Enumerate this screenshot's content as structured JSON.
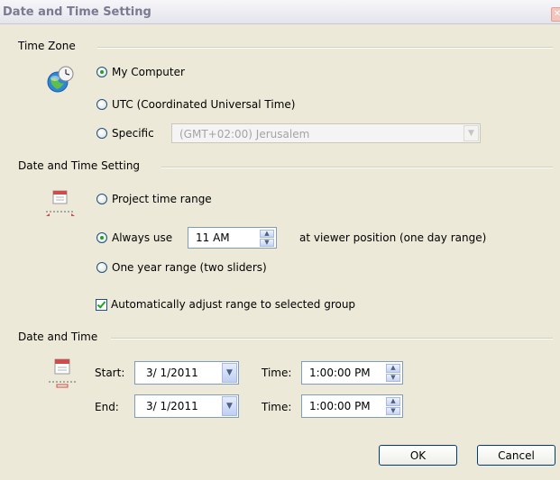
{
  "window": {
    "title": "Date and Time Setting",
    "close_glyph": "✕"
  },
  "time_zone": {
    "group_title": "Time Zone",
    "icon": "globe-clock-icon",
    "options": [
      {
        "label": "My Computer",
        "checked": true
      },
      {
        "label": "UTC (Coordinated Universal Time)",
        "checked": false
      },
      {
        "label": "Specific",
        "checked": false
      }
    ],
    "specific_select": {
      "value": "(GMT+02:00) Jerusalem",
      "enabled": false
    }
  },
  "date_time_setting": {
    "group_title": "Date and Time Setting",
    "icon": "timeline-calendar-icon",
    "options": [
      {
        "label": "Project time range",
        "checked": false
      },
      {
        "label": "Always use",
        "checked": true
      },
      {
        "label": "One year range (two sliders)",
        "checked": false
      }
    ],
    "always_use_value": "11 AM",
    "always_use_suffix": "at viewer position (one day range)",
    "auto_adjust": {
      "label": "Automatically adjust range to selected group",
      "checked": true
    }
  },
  "date_and_time": {
    "group_title": "Date and Time",
    "icon": "calendar-range-icon",
    "start": {
      "label": "Start:",
      "date": "3/ 1/2011",
      "time_label": "Time:",
      "time": "1:00:00 PM"
    },
    "end": {
      "label": "End:",
      "date": "3/ 1/2011",
      "time_label": "Time:",
      "time": "1:00:00 PM"
    }
  },
  "buttons": {
    "ok": "OK",
    "cancel": "Cancel"
  }
}
